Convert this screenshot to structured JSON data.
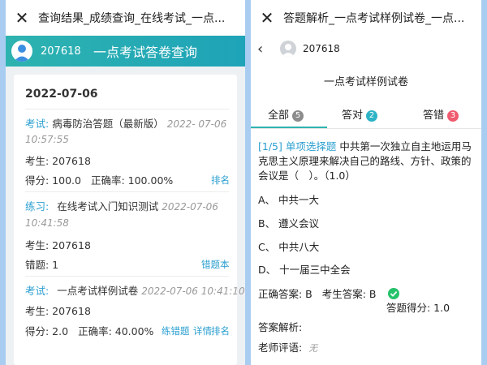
{
  "left": {
    "window_title": "查询结果_成绩查询_在线考试_一点...",
    "header": {
      "user_id": "207618",
      "title": "一点考试答卷查询"
    },
    "date": "2022-07-06",
    "records": [
      {
        "type": "考试:",
        "name": "病毒防治答题（最新版）",
        "time_a": "2022-  07-06",
        "time_b": "10:57:55",
        "examinee": "考生: 207618",
        "score": "得分: 100.0",
        "accuracy": "正确率: 100.00%",
        "links": [
          "排名"
        ]
      },
      {
        "type": "练习:",
        "name": "在线考试入门知识测试",
        "time_a": "2022-07-06",
        "time_b": "10:41:58",
        "examinee": "考生: 207618",
        "wrong": "错题: 1",
        "links": [
          "错题本"
        ]
      },
      {
        "type": "考试:",
        "name": "一点考试样例试卷",
        "time_a": "2022-07-06 10:41:10",
        "examinee": "考生: 207618",
        "score": "得分: 2.0",
        "accuracy": "正确率: 40.00%",
        "links": [
          "练错题",
          "详情",
          "排名"
        ]
      }
    ]
  },
  "right": {
    "window_title": "答题解析_一点考试样例试卷_一点...",
    "user_id": "207618",
    "exam_title": "一点考试样例试卷",
    "tabs": [
      {
        "label": "全部",
        "count": "5",
        "color": "#8c8c8c"
      },
      {
        "label": "答对",
        "count": "2",
        "color": "#2eb3c6"
      },
      {
        "label": "答错",
        "count": "3",
        "color": "#ef5b6f"
      }
    ],
    "question": {
      "tag": "[1/5] 单项选择题",
      "text": "中共第一次独立自主地运用马克思主义原理来解决自己的路线、方针、政策的会议是（　）。（1.0）",
      "options": [
        "A、 中共一大",
        "B、 遵义会议",
        "C、 中共八大",
        "D、 十一届三中全会"
      ],
      "correct_answer": "正确答案: B",
      "student_answer": "考生答案: B",
      "score": "答题得分: 1.0",
      "analysis_label": "答案解析:",
      "comment_label": "老师评语:",
      "comment_value": "无"
    }
  },
  "colors": {
    "accent": "#2eb3b0",
    "link": "#2b9fd0",
    "background": "#a9cdf1"
  }
}
